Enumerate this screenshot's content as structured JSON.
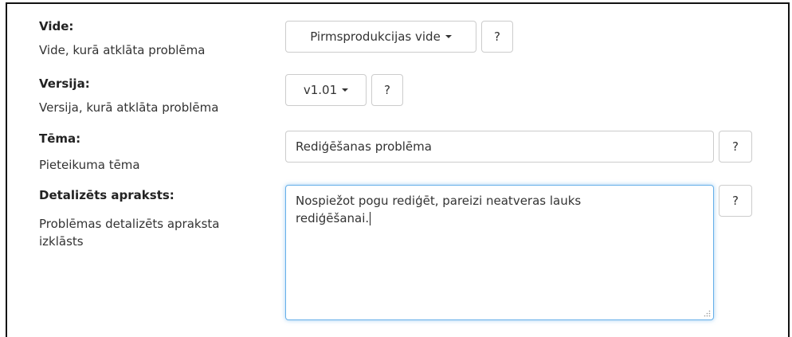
{
  "form": {
    "vide": {
      "label": "Vide:",
      "description": "Vide, kurā atklāta problēma",
      "selected": "Pirmsprodukcijas vide",
      "help": "?"
    },
    "versija": {
      "label": "Versija:",
      "description": "Versija, kurā atklāta problēma",
      "selected": "v1.01",
      "help": "?"
    },
    "tema": {
      "label": "Tēma:",
      "description": "Pieteikuma tēma",
      "value": "Rediģēšanas problēma",
      "help": "?"
    },
    "apraksts": {
      "label": "Detalizēts apraksts:",
      "description_line1": "Problēmas detalizēts apraksta",
      "description_line2": "izklāsts",
      "value_line1": "Nospiežot pogu rediģēt, pareizi neatveras lauks",
      "value_line2": "rediģēšanai.",
      "help": "?"
    }
  },
  "icons": {
    "dropdown": "caret-down-icon",
    "resize": "resize-grip-icon"
  },
  "colors": {
    "focus_border": "#66afe9",
    "border": "#cccccc",
    "text": "#333333"
  }
}
